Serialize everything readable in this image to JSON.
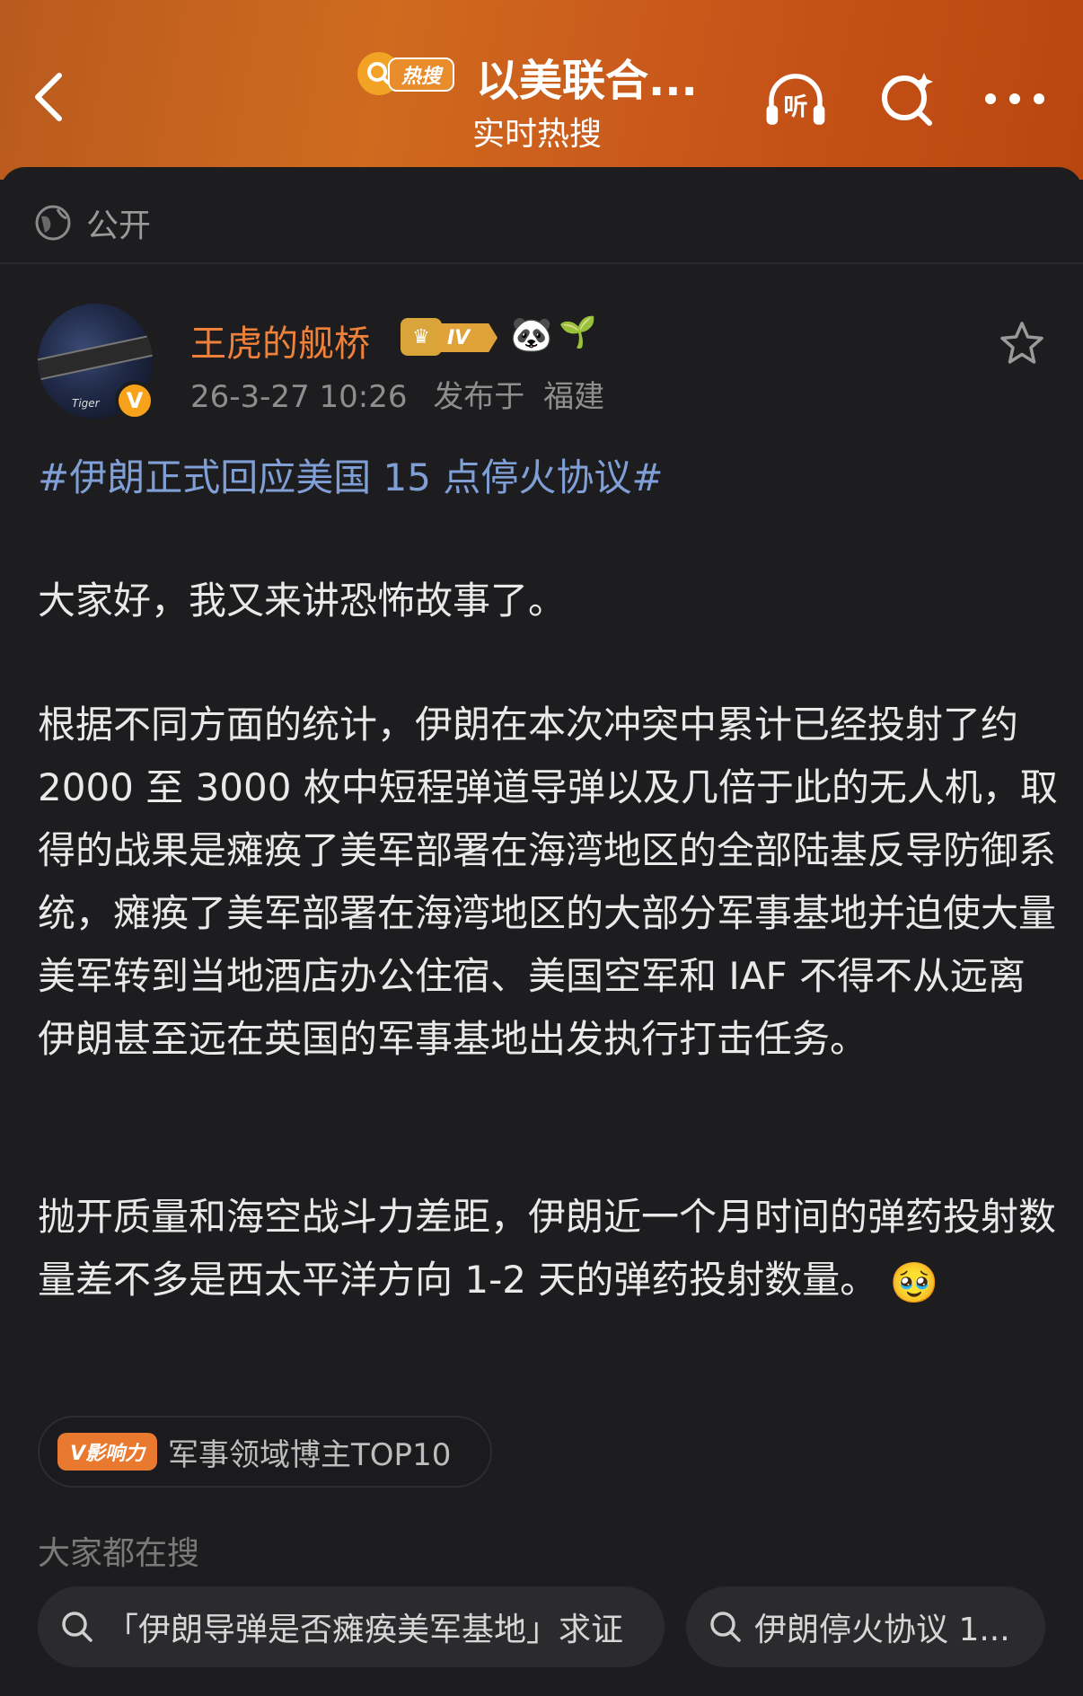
{
  "header": {
    "hot_tag": "热搜",
    "title": "以美联合...",
    "subtitle": "实时热搜",
    "listen_label": "听"
  },
  "visibility": {
    "label": "公开"
  },
  "post": {
    "username": "王虎的舰桥",
    "level": "IV",
    "verified_mark": "V",
    "avatar_text": "Tiger",
    "timestamp": "26-3-27 10:26",
    "published_from_label": "发布于",
    "location": "福建",
    "topic": "#伊朗正式回应美国 15 点停火协议#",
    "paragraphs": [
      "大家好，我又来讲恐怖故事了。",
      "根据不同方面的统计，伊朗在本次冲突中累计已经投射了约 2000 至 3000 枚中短程弹道导弹以及几倍于此的无人机，取得的战果是瘫痪了美军部署在海湾地区的全部陆基反导防御系统，瘫痪了美军部署在海湾地区的大部分军事基地并迫使大量美军转到当地酒店办公住宿、美国空军和 IAF 不得不从远离伊朗甚至远在英国的军事基地出发执行打击任务。",
      "抛开质量和海空战斗力差距，伊朗近一个月时间的弹药投射数量差不多是西太平洋方向 1-2 天的弹药投射数量。"
    ],
    "trailing_emoji": "🥹"
  },
  "influence": {
    "tag": "V影响力",
    "label": "军事领域博主TOP10"
  },
  "search": {
    "heading": "大家都在搜",
    "chips": [
      "「伊朗导弹是否瘫痪美军基地」求证",
      "伊朗停火协议 1..."
    ]
  },
  "colors": {
    "header_start": "#b95a1e",
    "header_end": "#b8460f",
    "username": "#f0813a",
    "topic": "#7f9fd6",
    "background": "#1d1d1f"
  }
}
